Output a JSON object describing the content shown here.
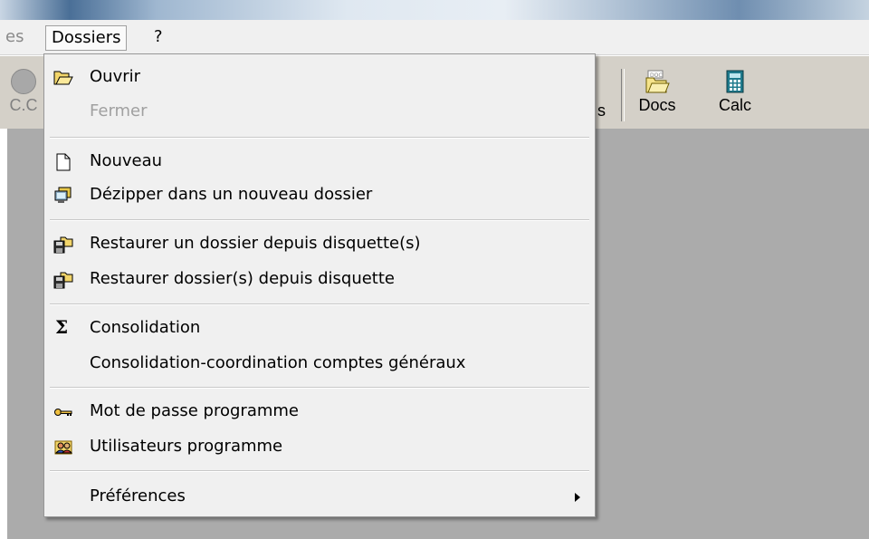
{
  "menubar": {
    "prev_label": "es",
    "dossiers_label": "Dossiers",
    "help_label": "?"
  },
  "toolbar": {
    "left_label": "C.C",
    "s_label": "s",
    "docs_label": "Docs",
    "calc_label": "Calc"
  },
  "menu": {
    "items": [
      {
        "label": "Ouvrir",
        "icon": "open-folder-icon"
      },
      {
        "label": "Fermer",
        "disabled": true
      },
      {
        "label": "Nouveau",
        "icon": "new-document-icon"
      },
      {
        "label": "Dézipper dans un nouveau dossier",
        "icon": "unzip-icon"
      },
      {
        "label": "Restaurer un dossier depuis disquette(s)",
        "icon": "restore-icon"
      },
      {
        "label": "Restaurer dossier(s) depuis disquette",
        "icon": "restore-icon"
      },
      {
        "label": "Consolidation",
        "icon": "sigma-icon"
      },
      {
        "label": "Consolidation-coordination comptes généraux"
      },
      {
        "label": "Mot de passe programme",
        "icon": "key-icon"
      },
      {
        "label": "Utilisateurs programme",
        "icon": "users-icon"
      },
      {
        "label": "Préférences",
        "submenu": true
      }
    ]
  },
  "colors": {
    "menu_bg": "#f0f0f0",
    "workspace": "#ababab",
    "toolbar": "#d4d0c8"
  }
}
